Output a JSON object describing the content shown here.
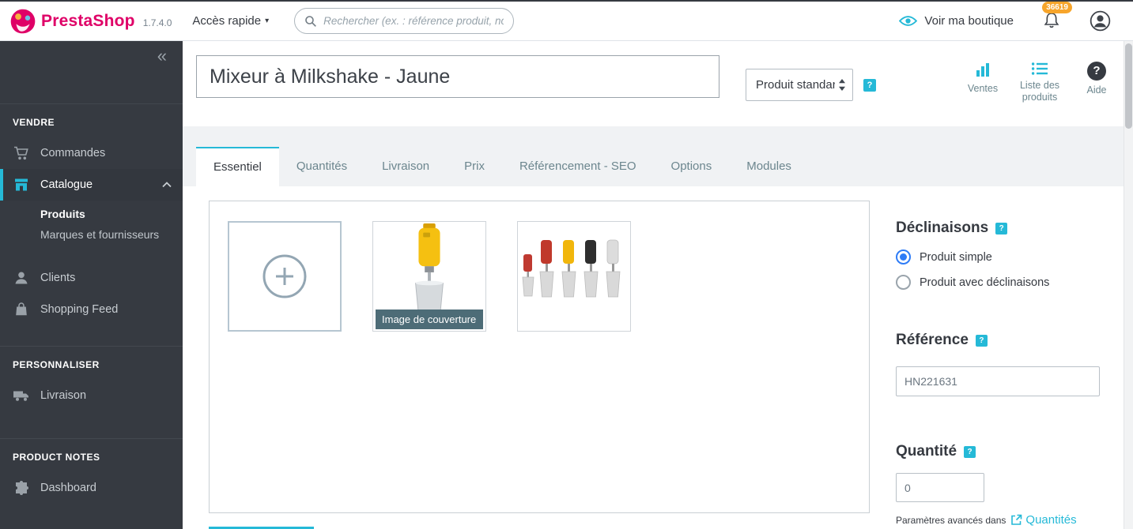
{
  "glyphs": {
    "help": "?",
    "collapse": "«",
    "caret_down": "▾"
  },
  "colors": {
    "accent_teal": "#25b9d7",
    "brand_pink": "#df0067",
    "sidebar_dark": "#363a41",
    "badge_orange": "#f7a52b",
    "radio_blue": "#2e7cf6",
    "cover_badge_bg": "#4d6c77"
  },
  "header": {
    "brand": "PrestaShop",
    "version": "1.7.4.0",
    "quick_access": "Accès rapide",
    "search_placeholder": "Rechercher (ex. : référence produit, nom",
    "view_shop": "Voir ma boutique",
    "notifications_badge": "36619"
  },
  "sidebar": {
    "sections": [
      {
        "title": "VENDRE",
        "items": [
          {
            "label": "Commandes"
          },
          {
            "label": "Catalogue",
            "children": [
              {
                "label": "Produits"
              },
              {
                "label": "Marques et fournisseurs"
              }
            ]
          },
          {
            "label": "Clients"
          },
          {
            "label": "Shopping Feed"
          }
        ]
      },
      {
        "title": "PERSONNALISER",
        "items": [
          {
            "label": "Livraison"
          }
        ]
      },
      {
        "title": "PRODUCT NOTES",
        "items": [
          {
            "label": "Dashboard"
          }
        ]
      }
    ]
  },
  "product_header": {
    "title_value": "Mixeur à Milkshake - Jaune",
    "type_value": "Produit standard",
    "actions": [
      {
        "label": "Ventes"
      },
      {
        "label": "Liste des produits"
      },
      {
        "label": "Aide"
      }
    ]
  },
  "tabs": [
    {
      "label": "Essentiel",
      "active": true
    },
    {
      "label": "Quantités"
    },
    {
      "label": "Livraison"
    },
    {
      "label": "Prix"
    },
    {
      "label": "Référencement - SEO"
    },
    {
      "label": "Options"
    },
    {
      "label": "Modules"
    }
  ],
  "gallery": {
    "cover_badge": "Image de couverture"
  },
  "panel": {
    "declinaisons": {
      "title": "Déclinaisons",
      "options": [
        {
          "label": "Produit simple",
          "selected": true
        },
        {
          "label": "Produit avec déclinaisons",
          "selected": false
        }
      ]
    },
    "reference": {
      "title": "Référence",
      "value": "HN221631"
    },
    "quantite": {
      "title": "Quantité",
      "value": "0",
      "advanced_prefix": "Paramètres avancés dans",
      "advanced_link": "Quantités"
    }
  }
}
